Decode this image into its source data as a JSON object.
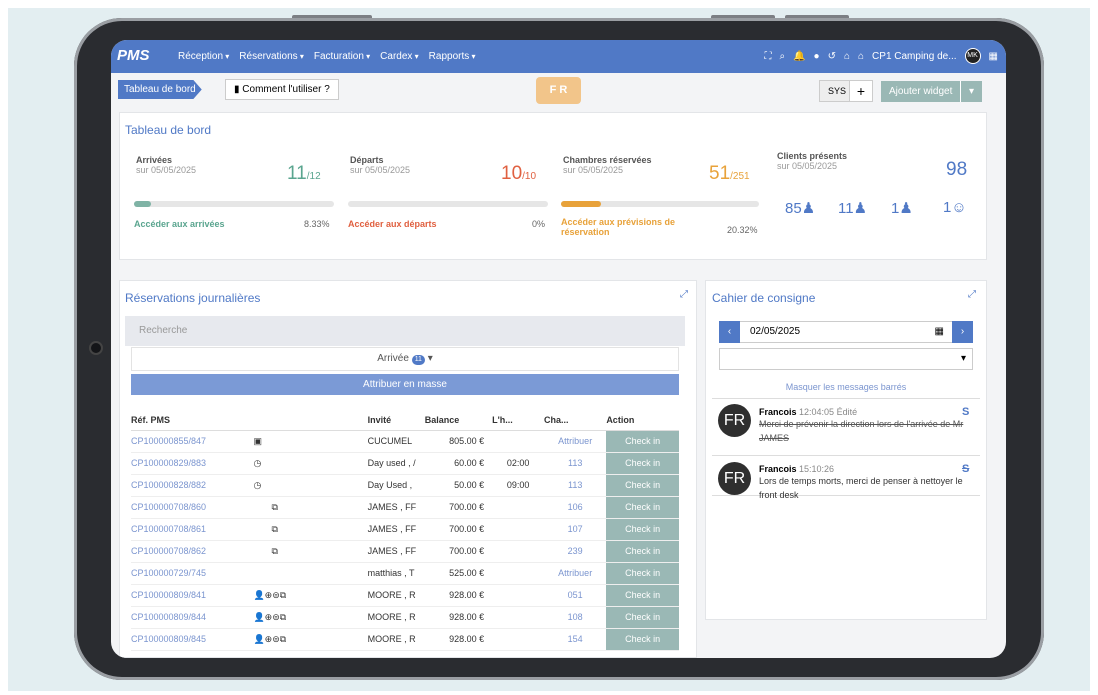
{
  "nav": {
    "logo": "PMS",
    "menu": [
      "Réception",
      "Réservations",
      "Facturation",
      "Cardex",
      "Rapports"
    ],
    "hotel": "CP1 Camping de...",
    "avatar": "MK"
  },
  "toolbar": {
    "crumb": "Tableau de bord",
    "howto": "Comment l'utiliser ?",
    "lang": "F R",
    "sys": "SYS",
    "add": "Ajouter widget"
  },
  "dash": {
    "title": "Tableau de bord",
    "arrivals": {
      "label": "Arrivées",
      "date": "sur 05/05/2025",
      "value": "11",
      "total": "/12",
      "link": "Accéder aux arrivées",
      "pct": "8.33%",
      "progress": 0.0833
    },
    "departures": {
      "label": "Départs",
      "date": "sur 05/05/2025",
      "value": "10",
      "total": "/10",
      "link": "Accéder aux départs",
      "pct": "0%",
      "progress": 0
    },
    "rooms": {
      "label": "Chambres réservées",
      "date": "sur 05/05/2025",
      "value": "51",
      "total": "/251",
      "link": "Accéder aux prévisions de réservation",
      "pct": "20.32%",
      "progress": 0.2032
    },
    "guests": {
      "label": "Clients présents",
      "date": "sur 05/05/2025",
      "total": "98",
      "adults": "85",
      "children": "11",
      "teens": "1",
      "babies": "1"
    }
  },
  "res": {
    "title": "Réservations journalières",
    "search": "Recherche",
    "filter": "Arrivée",
    "filter_count": "11",
    "mass": "Attribuer en masse",
    "headers": [
      "Réf. PMS",
      "",
      "Invité",
      "Balance",
      "L'h...",
      "Cha...",
      "Action"
    ],
    "rows": [
      [
        "CP100000855/847",
        "CUCUMEL",
        "805.00 €",
        "",
        "Attribuer",
        "Check in"
      ],
      [
        "CP100000829/883",
        "Day used , /",
        "60.00 €",
        "02:00",
        "113",
        "Check in"
      ],
      [
        "CP100000828/882",
        "Day Used ,",
        "50.00 €",
        "09:00",
        "113",
        "Check in"
      ],
      [
        "CP100000708/860",
        "JAMES , FF",
        "700.00 €",
        "",
        "106",
        "Check in"
      ],
      [
        "CP100000708/861",
        "JAMES , FF",
        "700.00 €",
        "",
        "107",
        "Check in"
      ],
      [
        "CP100000708/862",
        "JAMES , FF",
        "700.00 €",
        "",
        "239",
        "Check in"
      ],
      [
        "CP100000729/745",
        "matthias , T",
        "525.00 €",
        "",
        "Attribuer",
        "Check in"
      ],
      [
        "CP100000809/841",
        "MOORE , R",
        "928.00 €",
        "",
        "051",
        "Check in"
      ],
      [
        "CP100000809/844",
        "MOORE , R",
        "928.00 €",
        "",
        "108",
        "Check in"
      ],
      [
        "CP100000809/845",
        "MOORE , R",
        "928.00 €",
        "",
        "154",
        "Check in"
      ]
    ]
  },
  "log": {
    "title": "Cahier de consigne",
    "date": "02/05/2025",
    "hide": "Masquer les messages barrés",
    "entries": [
      {
        "initials": "FR",
        "author": "Francois",
        "time": "12:04:05 Édité",
        "text": "Merci de prévenir la direction lors de l'arrivée de Mr JAMES"
      },
      {
        "initials": "FR",
        "author": "Francois",
        "time": "15:10:26",
        "text": "Lors de temps morts, merci de penser à nettoyer le front desk"
      }
    ]
  }
}
